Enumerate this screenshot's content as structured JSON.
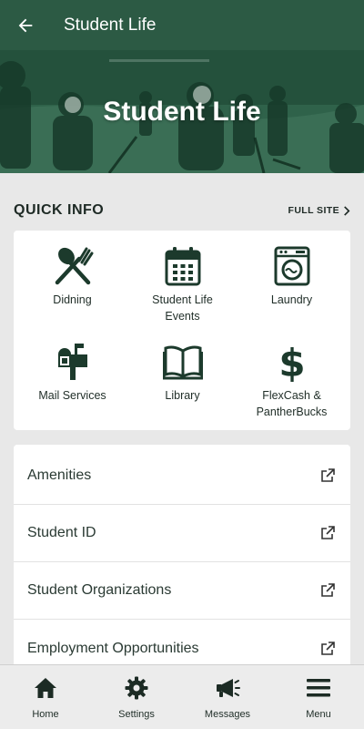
{
  "appbar": {
    "title": "Student Life"
  },
  "hero": {
    "title": "Student Life"
  },
  "quick_info": {
    "heading": "QUICK INFO",
    "full_site": "FULL SITE",
    "items": [
      {
        "label": "Didning",
        "icon": "fork-spoon-icon"
      },
      {
        "label": "Student Life Events",
        "icon": "calendar-icon"
      },
      {
        "label": "Laundry",
        "icon": "washing-machine-icon"
      },
      {
        "label": "Mail Services",
        "icon": "mailbox-icon"
      },
      {
        "label": "Library",
        "icon": "open-book-icon"
      },
      {
        "label": "FlexCash & PantherBucks",
        "icon": "dollar-icon"
      }
    ]
  },
  "links": [
    {
      "label": "Amenities"
    },
    {
      "label": "Student ID"
    },
    {
      "label": "Student Organizations"
    },
    {
      "label": "Employment Opportunities"
    }
  ],
  "tabs": [
    {
      "label": "Home",
      "icon": "home-icon"
    },
    {
      "label": "Settings",
      "icon": "gear-icon"
    },
    {
      "label": "Messages",
      "icon": "megaphone-icon"
    },
    {
      "label": "Menu",
      "icon": "hamburger-icon"
    }
  ],
  "colors": {
    "primary": "#2c5a44",
    "icon": "#1c3a2c",
    "background": "#e8e8e8"
  }
}
